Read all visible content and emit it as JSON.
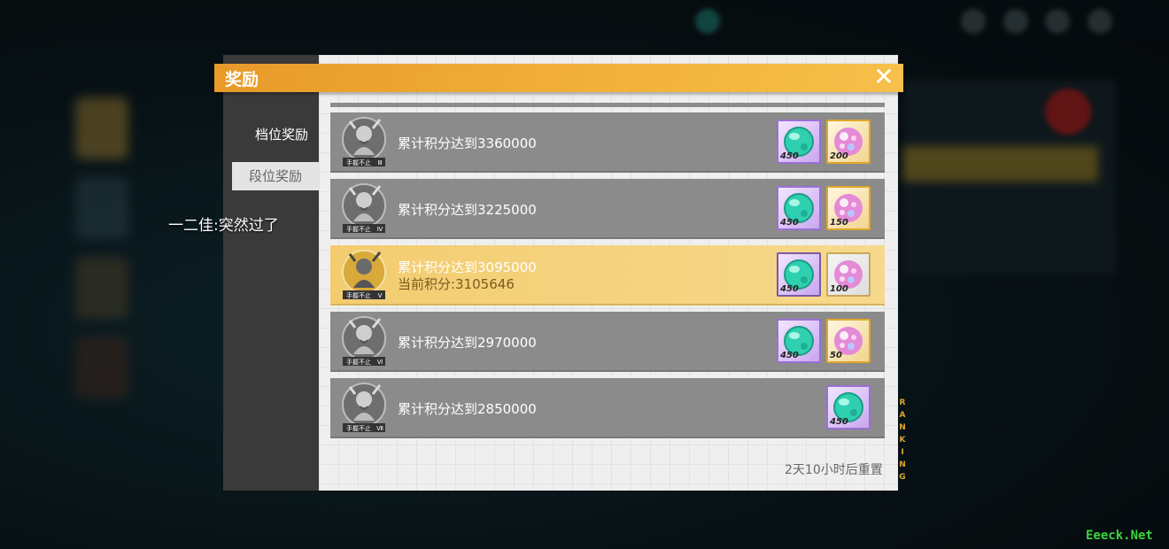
{
  "dialog": {
    "title": "奖励",
    "close_glyph": "✕"
  },
  "tabs": [
    {
      "label": "档位奖励",
      "active": true
    },
    {
      "label": "段位奖励",
      "active": false
    }
  ],
  "chat_message": "一二佳:突然过了",
  "badge_text": "手握不止",
  "tiers": [
    {
      "badge_numeral": "Ⅲ",
      "text": "累计积分达到3360000",
      "current_label": "",
      "rewards": [
        {
          "type": "gem",
          "qty": "450"
        },
        {
          "type": "orb",
          "qty": "200"
        }
      ]
    },
    {
      "badge_numeral": "Ⅳ",
      "text": "累计积分达到3225000",
      "current_label": "",
      "rewards": [
        {
          "type": "gem",
          "qty": "450"
        },
        {
          "type": "orb",
          "qty": "150"
        }
      ]
    },
    {
      "badge_numeral": "Ⅴ",
      "text": "累计积分达到3095000",
      "current_label": "当前积分:3105646",
      "rewards": [
        {
          "type": "gem",
          "qty": "450"
        },
        {
          "type": "orb",
          "qty": "100"
        }
      ]
    },
    {
      "badge_numeral": "Ⅵ",
      "text": "累计积分达到2970000",
      "current_label": "",
      "rewards": [
        {
          "type": "gem",
          "qty": "450"
        },
        {
          "type": "orb",
          "qty": "50"
        }
      ]
    },
    {
      "badge_numeral": "Ⅶ",
      "text": "累计积分达到2850000",
      "current_label": "",
      "rewards": [
        {
          "type": "gem",
          "qty": "450"
        }
      ]
    }
  ],
  "reset_text": "2天10小时后重置",
  "side_label": "RANKING",
  "watermark": "Eeeck.Net",
  "colors": {
    "accent": "#f2b23b",
    "current_row": "#f6d98c",
    "row": "#8b8b8b",
    "gem": "#2fd0b0",
    "orb": "#e58ad6"
  }
}
